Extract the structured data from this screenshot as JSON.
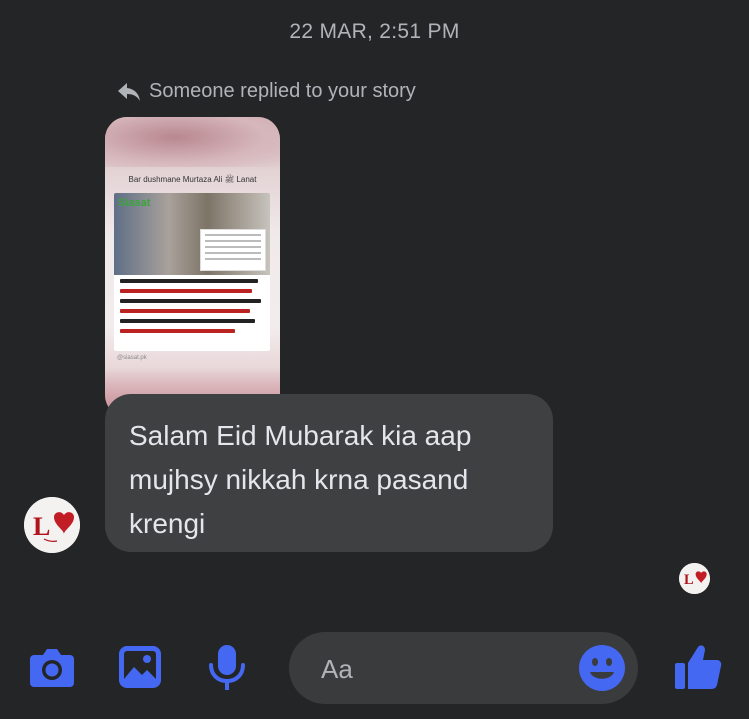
{
  "thread": {
    "timestamp": "22 MAR, 2:51 PM",
    "reply_notice": "Someone replied to your story"
  },
  "story": {
    "caption": "Bar dushmane Murtaza Ali ﷺ Lanat",
    "logo": "Siasat",
    "handle": "@siasat.pk"
  },
  "message": {
    "text": "Salam Eid Mubarak kia aap mujhsy nikkah krna pasand krengi"
  },
  "composer": {
    "placeholder": "Aa"
  },
  "colors": {
    "background": "#242526",
    "bubble": "#3e4042",
    "accent": "#4468f2",
    "muted_text": "#b0b3b8"
  },
  "icons": [
    "reply-arrow-icon",
    "camera-icon",
    "image-icon",
    "microphone-icon",
    "emoji-icon",
    "like-icon"
  ]
}
